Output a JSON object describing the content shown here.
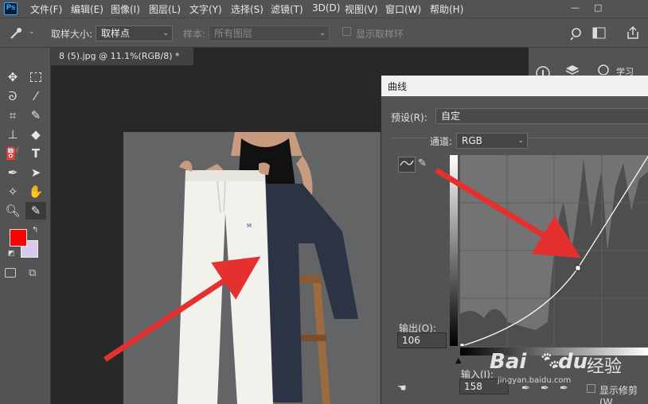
{
  "app": {
    "logo_text": "Ps"
  },
  "menu": [
    "文件(F)",
    "编辑(E)",
    "图像(I)",
    "图层(L)",
    "文字(Y)",
    "选择(S)",
    "滤镜(T)",
    "3D(D)",
    "视图(V)",
    "窗口(W)",
    "帮助(H)"
  ],
  "window_controls": {
    "minimize": "—",
    "maximize": "□"
  },
  "options": {
    "sample_size_label": "取样大小:",
    "sample_size_value": "取样点",
    "sample_label": "样本:",
    "sample_value": "所有图层",
    "show_ring_label": "显示取样环"
  },
  "document": {
    "tab_title": "8 (5).jpg @ 11.1%(RGB/8) *"
  },
  "right_panel": {
    "learn_label": "学习"
  },
  "curves": {
    "title": "曲线",
    "preset_label": "预设(R):",
    "preset_value": "自定",
    "channel_label": "通道:",
    "channel_value": "RGB",
    "output_label": "输出(O):",
    "output_value": "106",
    "input_label": "输入(I):",
    "input_value": "158",
    "clip_label": "显示修剪(W",
    "control_point": {
      "input": 158,
      "output": 106
    }
  },
  "watermark": {
    "brand": "Bai",
    "brand2": "du",
    "suffix": "经验",
    "url": "jingyan.baidu.com"
  },
  "colors": {
    "foreground": "#ff0000",
    "background": "#d8c8ec",
    "arrow": "#e53030",
    "ps_blue": "#31a8ff"
  }
}
